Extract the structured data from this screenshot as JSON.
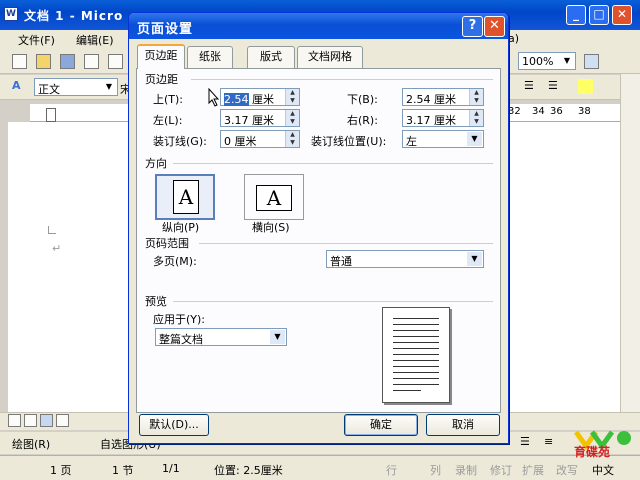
{
  "word": {
    "title": "文档 1 - Micro",
    "menu": [
      "文件(F)",
      "编辑(E)",
      "a)"
    ],
    "toolbar_style": "正文",
    "toolbar_font_prefix": "宋",
    "zoom": "100%",
    "ruler_ticks": [
      "32",
      "34",
      "36",
      "38"
    ],
    "draw_label": "绘图(R)",
    "autoshape_label": "自选图形(U)",
    "status": {
      "page": "1 页",
      "section": "1 节",
      "pages": "1/1",
      "position": "位置: 2.5厘米",
      "modes": [
        "行",
        "列",
        "录制",
        "修订",
        "扩展",
        "改写"
      ],
      "language": "中文"
    },
    "logo_text": "育碟苑"
  },
  "dialog": {
    "title": "页面设置",
    "help": "?",
    "close": "✕",
    "tabs": [
      "页边距",
      "纸张",
      "版式",
      "文档网格"
    ],
    "margins": {
      "section": "页边距",
      "top_label": "上(T):",
      "top_value": "2.54 厘米",
      "bottom_label": "下(B):",
      "bottom_value": "2.54 厘米",
      "left_label": "左(L):",
      "left_value": "3.17 厘米",
      "right_label": "右(R):",
      "right_value": "3.17 厘米",
      "gutter_label": "装订线(G):",
      "gutter_value": "0 厘米",
      "gutter_pos_label": "装订线位置(U):",
      "gutter_pos_value": "左"
    },
    "orientation": {
      "section": "方向",
      "portrait": "纵向(P)",
      "landscape": "横向(S)",
      "glyph": "A"
    },
    "pages": {
      "section": "页码范围",
      "multi_label": "多页(M):",
      "multi_value": "普通"
    },
    "preview": {
      "section": "预览",
      "apply_label": "应用于(Y):",
      "apply_value": "整篇文档"
    },
    "buttons": {
      "default": "默认(D)...",
      "ok": "确定",
      "cancel": "取消"
    }
  }
}
